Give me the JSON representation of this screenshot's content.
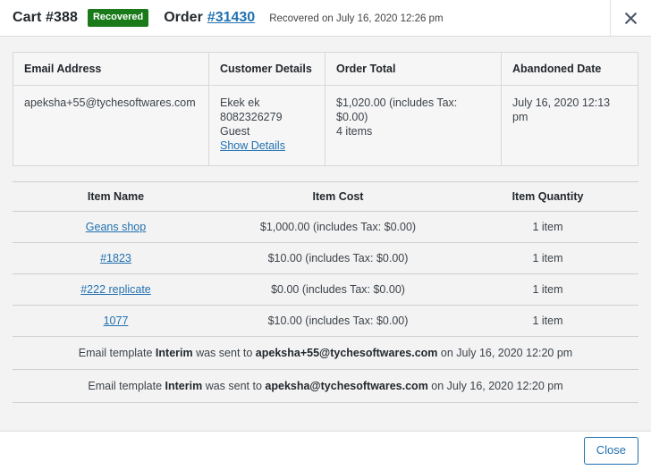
{
  "header": {
    "cart_title": "Cart #388",
    "status_badge": "Recovered",
    "order_label": "Order",
    "order_link": "#31430",
    "recovered_note": "Recovered on July 16, 2020 12:26 pm",
    "close_icon": "close-icon",
    "badge_color": "#1a7a1a",
    "link_color": "#2271b1"
  },
  "summary": {
    "headers": {
      "email": "Email Address",
      "customer": "Customer Details",
      "total": "Order Total",
      "abandoned": "Abandoned Date"
    },
    "row": {
      "email": "apeksha+55@tychesoftwares.com",
      "customer_name": "Ekek ek",
      "customer_phone": "8082326279",
      "customer_type": "Guest",
      "customer_details_link": "Show Details",
      "order_total": "$1,020.00 (includes Tax: $0.00)",
      "order_items": "4 items",
      "abandoned_date": "July 16, 2020 12:13 pm"
    }
  },
  "items": {
    "headers": {
      "name": "Item Name",
      "cost": "Item Cost",
      "quantity": "Item Quantity"
    },
    "rows": [
      {
        "name": "Geans shop",
        "cost": "$1,000.00 (includes Tax: $0.00)",
        "quantity": "1 item"
      },
      {
        "name": "#1823",
        "cost": "$10.00 (includes Tax: $0.00)",
        "quantity": "1 item"
      },
      {
        "name": "#222 replicate",
        "cost": "$0.00 (includes Tax: $0.00)",
        "quantity": "1 item"
      },
      {
        "name": "1077",
        "cost": "$10.00 (includes Tax: $0.00)",
        "quantity": "1 item"
      }
    ]
  },
  "email_log": [
    {
      "prefix": "Email template ",
      "template": "Interim",
      "middle": " was sent to ",
      "recipient": "apeksha+55@tychesoftwares.com",
      "suffix": " on July 16, 2020 12:20 pm"
    },
    {
      "prefix": "Email template ",
      "template": "Interim",
      "middle": " was sent to ",
      "recipient": "apeksha@tychesoftwares.com",
      "suffix": " on July 16, 2020 12:20 pm"
    }
  ],
  "footer": {
    "close_label": "Close"
  }
}
